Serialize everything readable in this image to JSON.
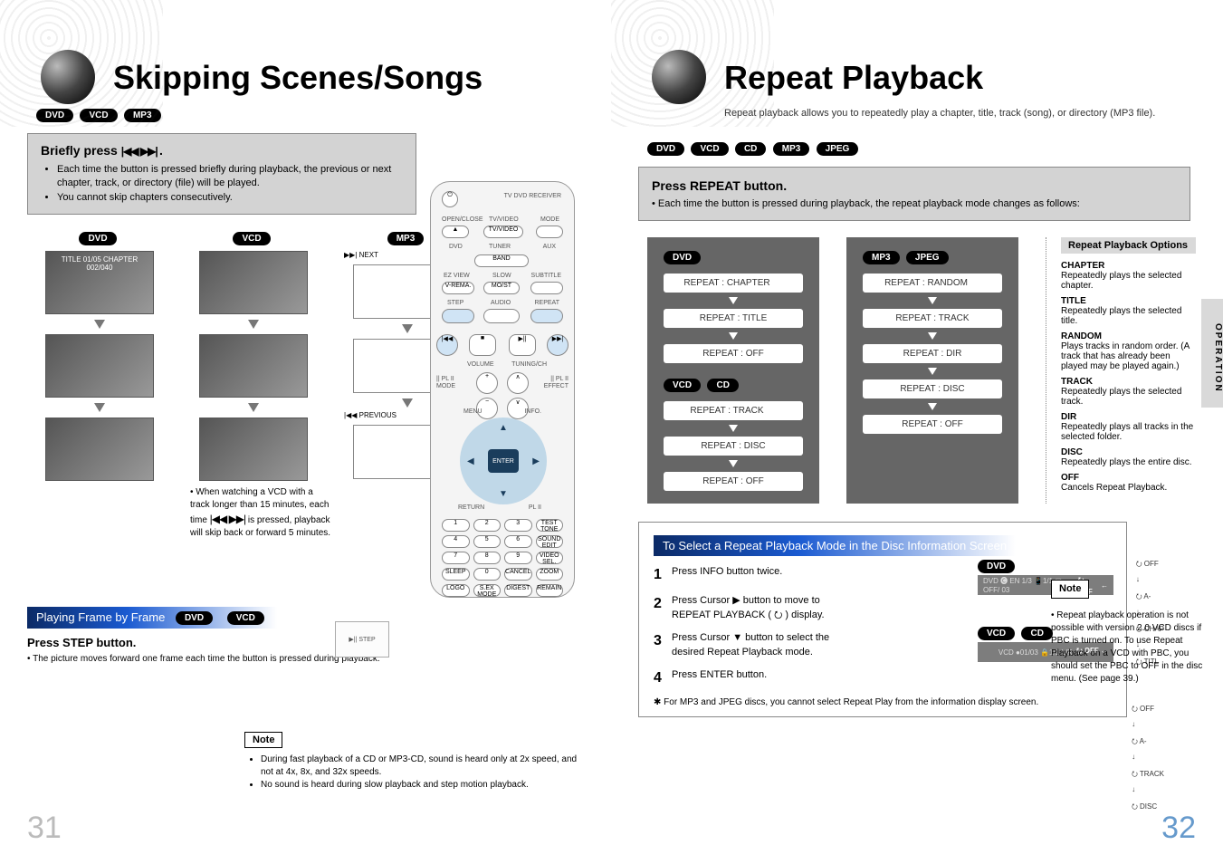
{
  "left": {
    "title": "Skipping Scenes/Songs",
    "lozenges_top": [
      "DVD",
      "VCD",
      "MP3"
    ],
    "briefly": {
      "heading_prefix": "Briefly press ",
      "heading_glyph": "|◀◀ ▶▶| ",
      "heading_suffix": ".",
      "bullets": [
        "Each time the button is pressed briefly during playback, the previous or next chapter, track, or directory (file) will be played.",
        "You cannot skip chapters consecutively."
      ]
    },
    "media_cols": {
      "dvd": "DVD",
      "vcd": "VCD",
      "mp3": "MP3"
    },
    "dvd_thumb1_caption": "TITLE 01/05 CHAPTER 002/040",
    "mp3_panel_labels": {
      "next": "▶▶| NEXT",
      "prev": "|◀◀ PREVIOUS"
    },
    "vcd_note_prefix": "• When watching a VCD with a track longer than 15 minutes, each time ",
    "vcd_note_glyph": "|◀◀ ▶▶|",
    "vcd_note_suffix": " is pressed, playback will skip back or forward 5 minutes.",
    "frame": {
      "bar": "Playing Frame by Frame",
      "bar_lozenges": [
        "DVD",
        "VCD"
      ],
      "step_heading": "Press STEP button.",
      "step_bullet": "• The picture moves forward one frame each time the button is pressed during playback.",
      "step_thumb_label": "▶|| STEP"
    },
    "note": {
      "label": "Note",
      "bullets": [
        "During fast playback of a CD or MP3-CD, sound is heard only at 2x speed, and not at 4x, 8x, and 32x speeds.",
        "No sound is heard during slow playback and step motion playback."
      ]
    },
    "remote": {
      "top_label": "TV   DVD RECEIVER",
      "rows": [
        [
          "OPEN/CLOSE",
          "TV/VIDEO",
          "MODE"
        ],
        [
          "DVD",
          "TUNER",
          "AUX"
        ],
        [
          "",
          "BAND",
          ""
        ],
        [
          "EZ VIEW",
          "SLOW",
          "SUBTITLE"
        ],
        [
          "V-REMA.",
          "MO/ST",
          ""
        ],
        [
          "STEP",
          "AUDIO",
          "REPEAT"
        ]
      ],
      "prev_glyph": "|◀◀",
      "stop_glyph": "■",
      "play_glyph": "▶||",
      "next_glyph": "▶▶|",
      "volume": "VOLUME",
      "tuning": "TUNING/CH",
      "plr_l": "|| PL II MODE",
      "plr_r": "|| PL II EFFECT",
      "enter": "ENTER",
      "arc_labels": [
        "MENU",
        "INFO.",
        "RETURN",
        "PL II"
      ],
      "bottom_grid": [
        "1",
        "2",
        "3",
        "TEST TONE",
        "4",
        "5",
        "6",
        "SOUND EDIT",
        "7",
        "8",
        "9",
        "VIDEO SEL.",
        "SLEEP",
        "0",
        "CANCEL",
        "ZOOM",
        "LOGO",
        "S.EX MODE",
        "DIGEST",
        "REMAIN"
      ]
    },
    "page_number": "31"
  },
  "right": {
    "title": "Repeat Playback",
    "subtitle": "Repeat playback allows you to repeatedly play a chapter, title, track (song), or directory (MP3 file).",
    "lozenges_top": [
      "DVD",
      "VCD",
      "CD",
      "MP3",
      "JPEG"
    ],
    "press": {
      "heading": "Press REPEAT button.",
      "bullet": "• Each time the button is pressed during playback, the repeat playback mode changes as follows:"
    },
    "flow_dvd": {
      "loz": "DVD",
      "steps": [
        "REPEAT : CHAPTER",
        "REPEAT : TITLE",
        "REPEAT : OFF"
      ]
    },
    "flow_vcd_cd": {
      "loz": [
        "VCD",
        "CD"
      ],
      "steps": [
        "REPEAT : TRACK",
        "REPEAT : DISC",
        "REPEAT : OFF"
      ]
    },
    "flow_mp3": {
      "loz": [
        "MP3",
        "JPEG"
      ],
      "steps": [
        "REPEAT : RANDOM",
        "REPEAT : TRACK",
        "REPEAT : DIR",
        "REPEAT : DISC",
        "REPEAT : OFF"
      ]
    },
    "options": {
      "header": "Repeat Playback Options",
      "items": [
        {
          "t": "CHAPTER",
          "d": "Repeatedly plays the selected chapter."
        },
        {
          "t": "TITLE",
          "d": "Repeatedly plays the selected title."
        },
        {
          "t": "RANDOM",
          "d": "Plays tracks in random order. (A track that has already been played may be played again.)"
        },
        {
          "t": "TRACK",
          "d": "Repeatedly plays the selected track."
        },
        {
          "t": "DIR",
          "d": "Repeatedly plays all tracks in the selected folder."
        },
        {
          "t": "DISC",
          "d": "Repeatedly plays the entire disc."
        },
        {
          "t": "OFF",
          "d": "Cancels Repeat Playback."
        }
      ]
    },
    "select": {
      "bar": "To Select a Repeat Playback Mode in the Disc Information Screen",
      "steps": [
        {
          "n": "1",
          "t": "Press INFO button twice."
        },
        {
          "n": "2",
          "t": "Press Cursor ▶ button to move to REPEAT PLAYBACK ( ⭮ ) display."
        },
        {
          "n": "3",
          "t": "Press Cursor ▼ button to select the desired Repeat Playback mode."
        },
        {
          "n": "4",
          "t": "Press ENTER button."
        }
      ],
      "footnote": "✱ For MP3 and JPEG discs, you cannot select Repeat Play from the information display screen.",
      "panel_dvd": {
        "loz": "DVD",
        "row": "DVD  🅒 EN 1/3  📱1/1  ▢ OFF/  03",
        "tail": "⭮ OFF"
      },
      "panel_vcd": {
        "loz": [
          "VCD",
          "CD"
        ],
        "row": "VCD  ●01/03  🔒1/1  L/R",
        "tail": "⭮ OFF ←"
      },
      "side_list_dvd": [
        "⭮ OFF",
        "↓",
        "⭮ A-",
        "↓",
        "⭮ CHAP",
        "↓",
        "⭮ TITL"
      ],
      "side_list_vcd": [
        "⭮ OFF",
        "↓",
        "⭮ A-",
        "↓",
        "⭮ TRACK",
        "↓",
        "⭮ DISC"
      ]
    },
    "note": {
      "label": "Note",
      "text": "• Repeat playback operation is not possible with version 2.0 VCD discs if PBC is turned on. To use Repeat Playback on a VCD with PBC, you should set the PBC to OFF in the disc menu. (See page 39.)"
    },
    "side_tab": "OPERATION",
    "page_number": "32"
  }
}
